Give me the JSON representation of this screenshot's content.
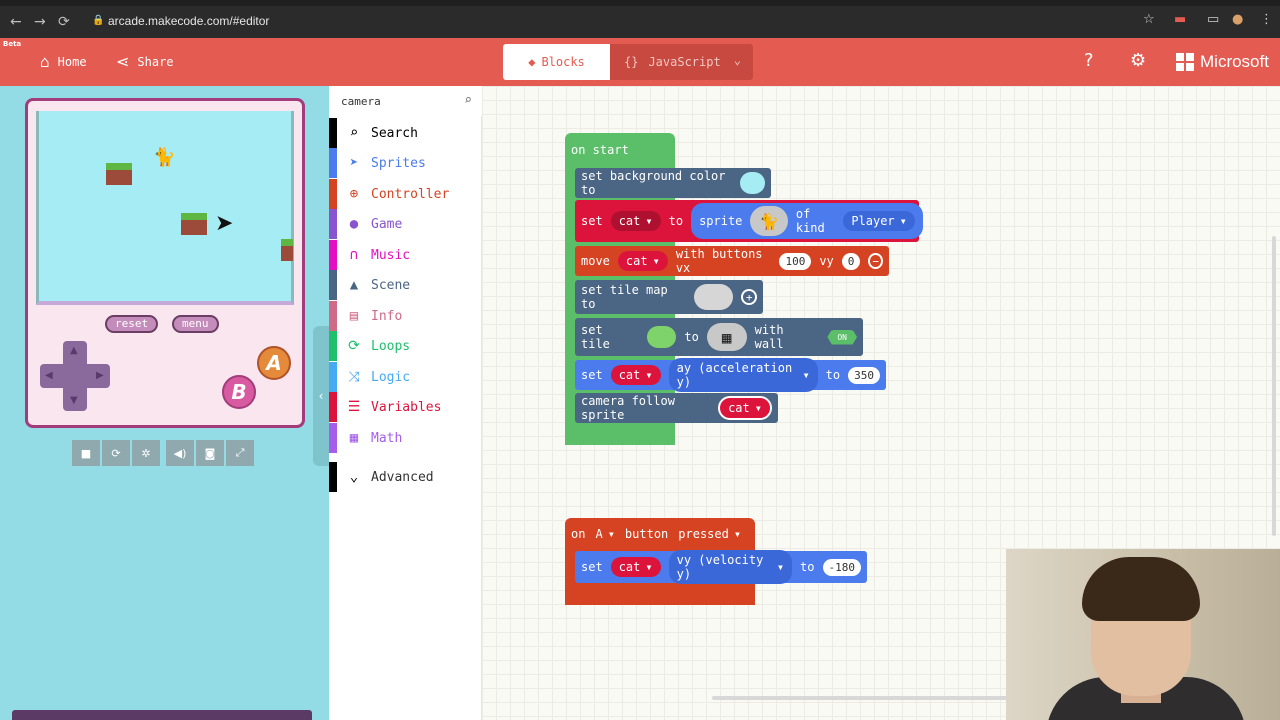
{
  "browser": {
    "url": "arcade.makecode.com/#editor"
  },
  "header": {
    "beta": "Beta",
    "home": "Home",
    "share": "Share",
    "tab_blocks": "Blocks",
    "tab_js": "JavaScript",
    "js_prefix": "{}",
    "brand": "Microsoft",
    "accent": "#e45b52"
  },
  "simulator": {
    "reset": "reset",
    "menu": "menu",
    "btn_a": "A",
    "btn_b": "B"
  },
  "toolbox": {
    "search_value": "camera",
    "categories": [
      {
        "label": "Search",
        "icon": "search-icon",
        "color": "#000000"
      },
      {
        "label": "Sprites",
        "icon": "paper-plane-icon",
        "color": "#4b7bec"
      },
      {
        "label": "Controller",
        "icon": "gamepad-icon",
        "color": "#d54322"
      },
      {
        "label": "Game",
        "icon": "circle-icon",
        "color": "#8854d0"
      },
      {
        "label": "Music",
        "icon": "headphones-icon",
        "color": "#e30fc0"
      },
      {
        "label": "Scene",
        "icon": "tree-icon",
        "color": "#4b6584"
      },
      {
        "label": "Info",
        "icon": "id-card-icon",
        "color": "#cf6a87"
      },
      {
        "label": "Loops",
        "icon": "refresh-icon",
        "color": "#20bf6b"
      },
      {
        "label": "Logic",
        "icon": "shuffle-icon",
        "color": "#45aaf2"
      },
      {
        "label": "Variables",
        "icon": "list-icon",
        "color": "#dc143c"
      },
      {
        "label": "Math",
        "icon": "calculator-icon",
        "color": "#a55eea"
      }
    ],
    "advanced": "Advanced"
  },
  "workspace": {
    "on_start": "on start",
    "set_bg": "set background color to",
    "set": "set",
    "cat": "cat",
    "to": "to",
    "sprite": "sprite",
    "of_kind": "of kind",
    "player": "Player",
    "move": "move",
    "with_buttons_vx": "with buttons vx",
    "vx_value": "100",
    "vy": "vy",
    "vy_value": "0",
    "set_tile_map": "set tile map to",
    "set_tile": "set tile",
    "with_wall": "with wall",
    "on_toggle": "ON",
    "ay": "ay (acceleration y)",
    "ay_value": "350",
    "camera_follow": "camera follow sprite",
    "on": "on",
    "a": "A",
    "button": "button",
    "pressed": "pressed",
    "vy_velocity": "vy (velocity y)",
    "vy_velocity_value": "-180"
  }
}
